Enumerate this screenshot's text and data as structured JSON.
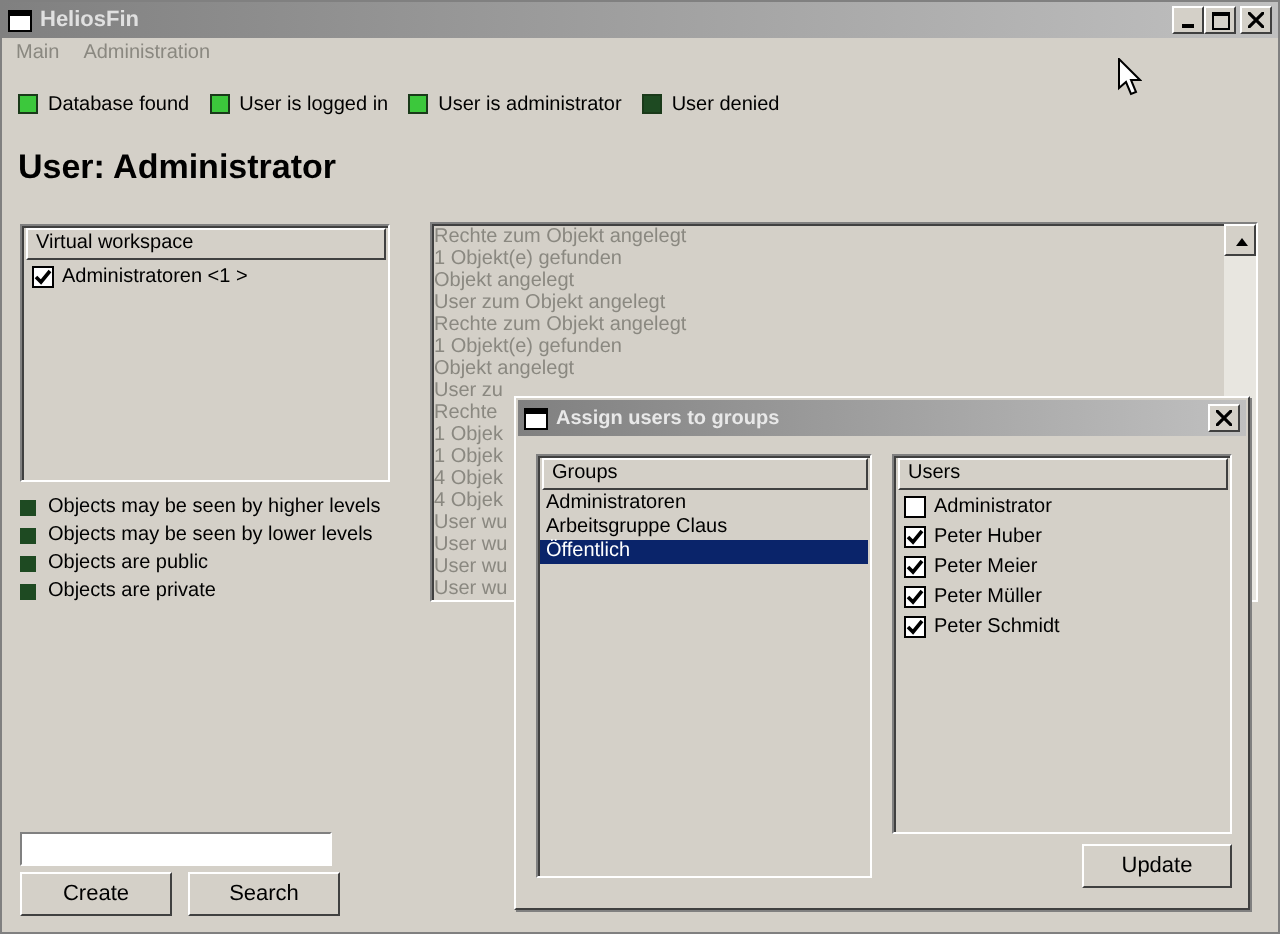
{
  "window": {
    "title": "HeliosFin"
  },
  "menu": [
    "Main",
    "Administration"
  ],
  "status": [
    {
      "label": "Database found",
      "on": true
    },
    {
      "label": "User is logged in",
      "on": true
    },
    {
      "label": "User is administrator",
      "on": true
    },
    {
      "label": "User denied",
      "on": false
    }
  ],
  "heading": "User: Administrator",
  "workspace": {
    "header": "Virtual workspace",
    "items": [
      {
        "label": "Administratoren <1 >",
        "checked": true
      }
    ]
  },
  "legend": [
    "Objects may be seen by higher levels",
    "Objects may be seen by lower levels",
    "Objects are public",
    "Objects are private"
  ],
  "log": [
    "Rechte zum Objekt angelegt",
    "1 Objekt(e) gefunden",
    "Objekt angelegt",
    "User zum Objekt angelegt",
    "Rechte zum Objekt angelegt",
    "1 Objekt(e) gefunden",
    "Objekt angelegt",
    "User zu",
    "Rechte",
    "1 Objek",
    "1 Objek",
    "4 Objek",
    "4 Objek",
    "User wu",
    "User wu",
    "User wu",
    "User wu"
  ],
  "buttons": [
    "Create",
    "Search"
  ],
  "dialog": {
    "title": "Assign users to groups",
    "groups": {
      "header": "Groups",
      "items": [
        {
          "label": "Administratoren",
          "selected": false
        },
        {
          "label": "Arbeitsgruppe Claus",
          "selected": false
        },
        {
          "label": "Öffentlich",
          "selected": true
        }
      ]
    },
    "users": {
      "header": "Users",
      "items": [
        {
          "label": "Administrator",
          "checked": false
        },
        {
          "label": "Peter Huber",
          "checked": true
        },
        {
          "label": "Peter Meier",
          "checked": true
        },
        {
          "label": "Peter Müller",
          "checked": true
        },
        {
          "label": "Peter Schmidt",
          "checked": true
        }
      ]
    },
    "button": "Update"
  }
}
